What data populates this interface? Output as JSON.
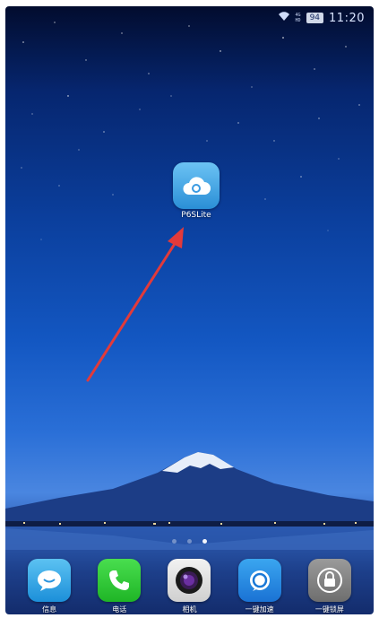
{
  "status_bar": {
    "wifi_icon": "wifi-icon",
    "signal_1": "4G",
    "signal_2": "HD",
    "battery": "94",
    "time": "11:20"
  },
  "home": {
    "app": {
      "label": "P6SLite",
      "icon": "cloud-camera-icon",
      "color": "#3a9ee6"
    },
    "page_indicator": {
      "pages": 3,
      "active": 3
    }
  },
  "dock": {
    "items": [
      {
        "label": "信息",
        "icon": "message-bubble-icon"
      },
      {
        "label": "电话",
        "icon": "phone-icon"
      },
      {
        "label": "相机",
        "icon": "camera-lens-icon"
      },
      {
        "label": "一键加速",
        "icon": "speed-boost-icon"
      },
      {
        "label": "一键锁屏",
        "icon": "lock-icon"
      }
    ]
  },
  "annotation": {
    "icon": "red-arrow-icon",
    "color": "#e23a3a"
  }
}
